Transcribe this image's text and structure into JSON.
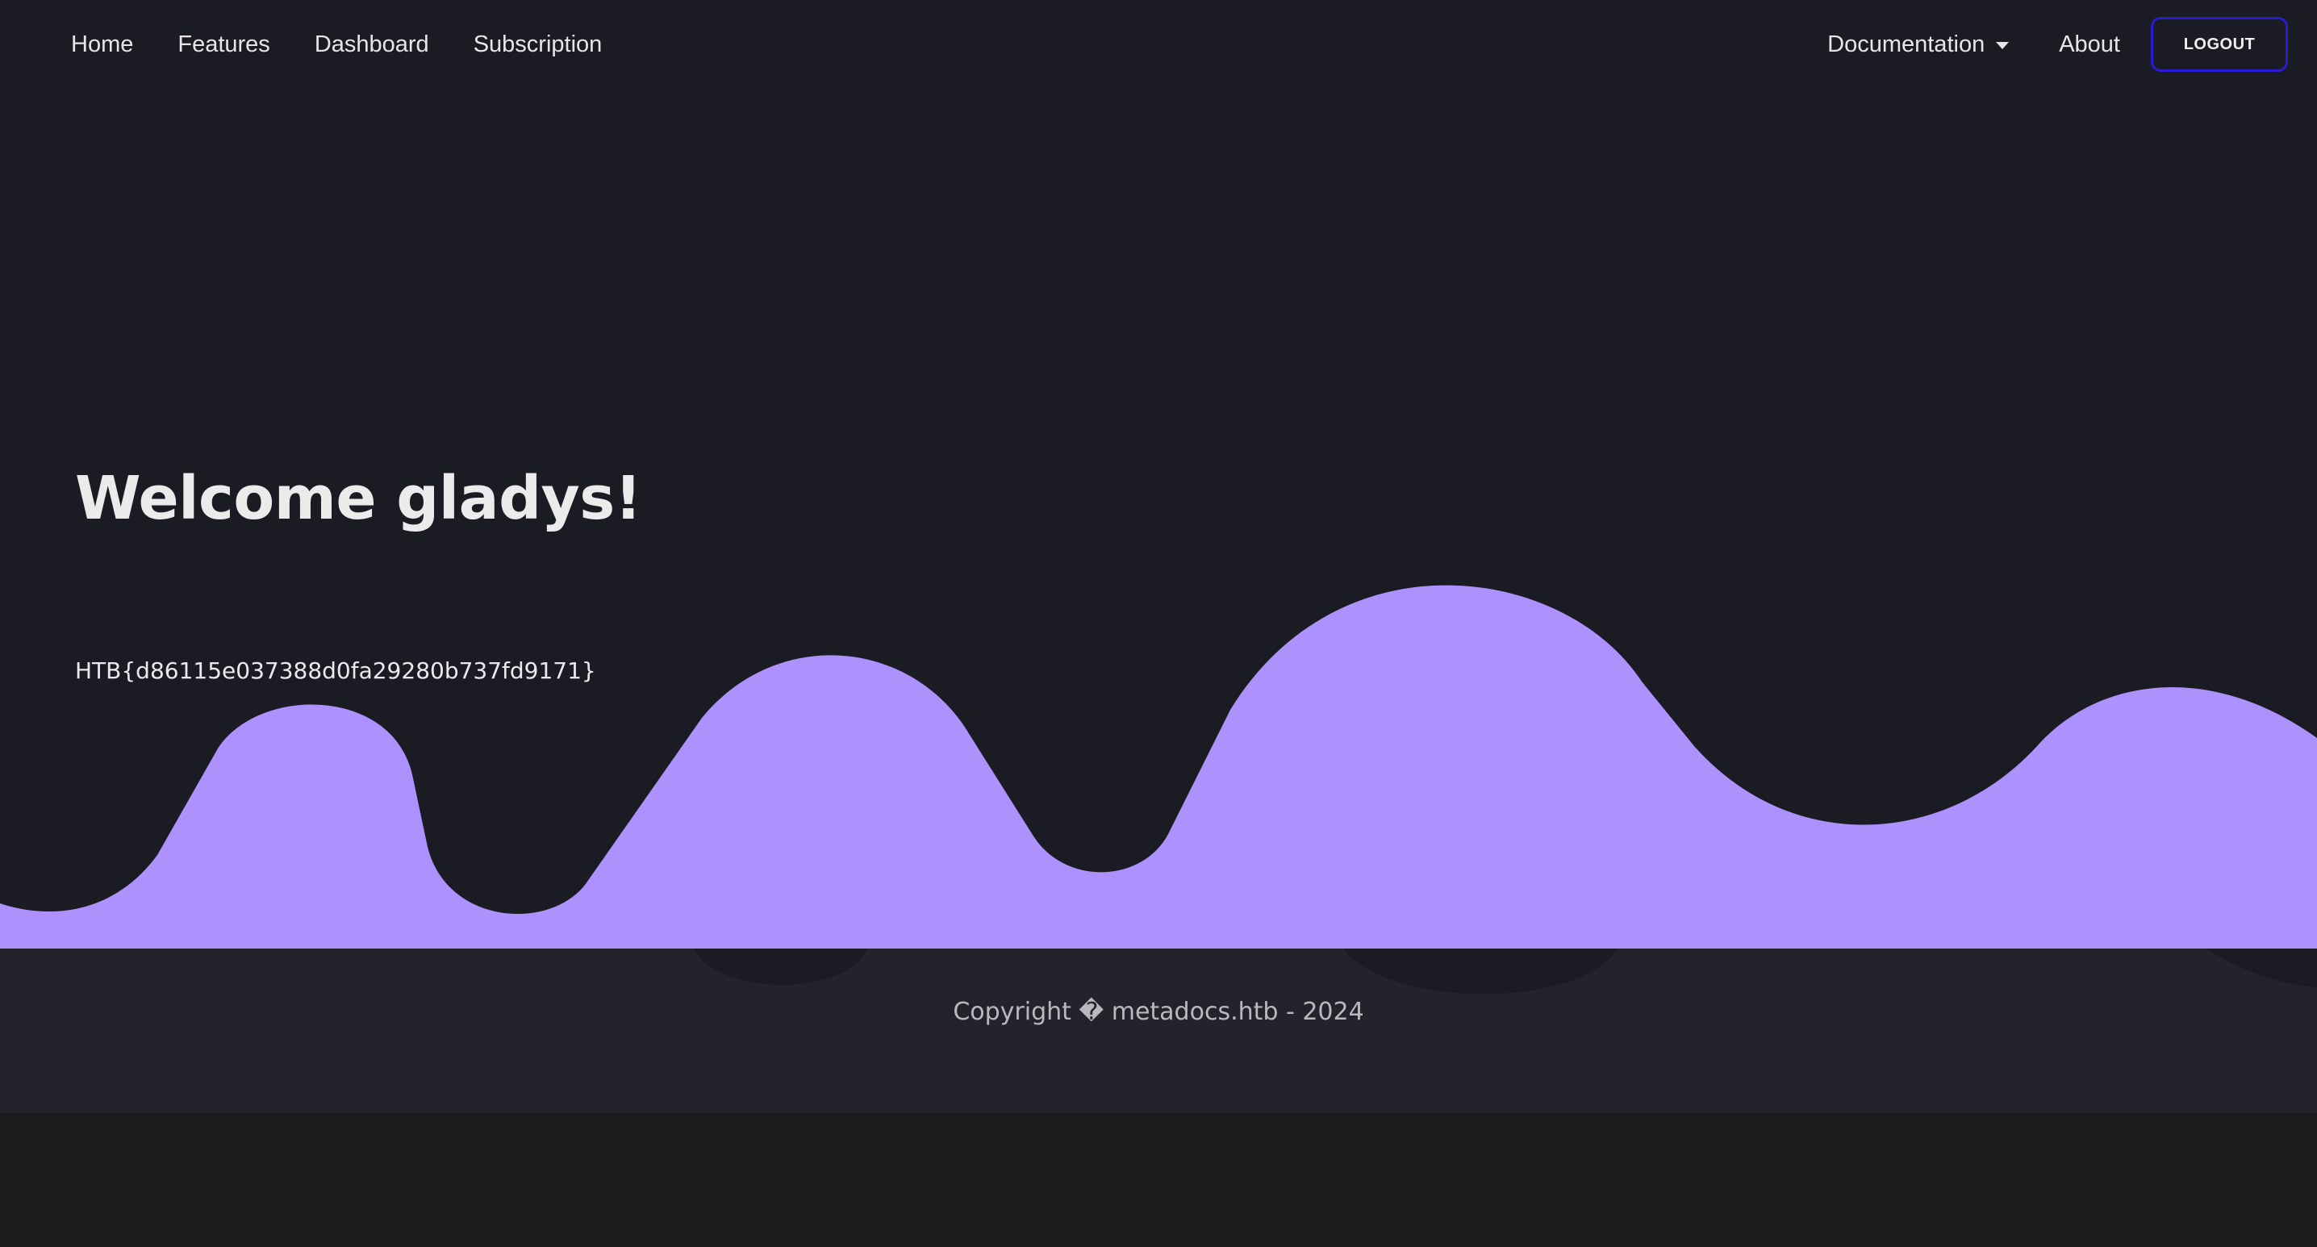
{
  "nav": {
    "left_links": [
      "Home",
      "Features",
      "Dashboard",
      "Subscription"
    ],
    "documentation_label": "Documentation",
    "about_label": "About",
    "logout_label": "LOGOUT"
  },
  "hero": {
    "welcome": "Welcome gladys!",
    "flag": "HTB{d86115e037388d0fa29280b737fd9171}"
  },
  "footer": {
    "copyright": "Copyright � metadocs.htb - 2024"
  },
  "colors": {
    "page_background": "#1b1b23",
    "wave": "#ad92fd",
    "footer_background": "#23232c",
    "logout_border": "#2a1bd0",
    "bottom_strip": "#1b1c1e"
  }
}
